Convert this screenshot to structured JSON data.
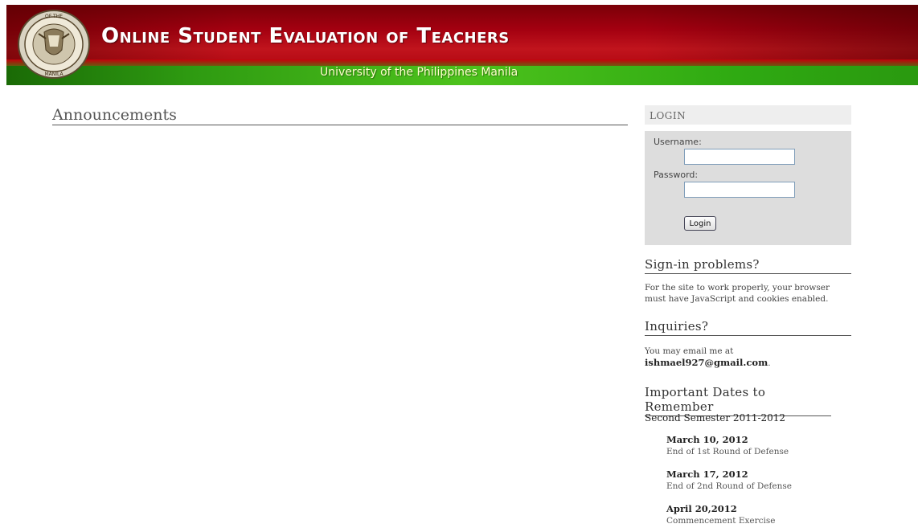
{
  "header": {
    "title": "Online Student Evaluation of Teachers",
    "subtitle": "University of the Philippines Manila",
    "seal_text_top": "OF THE",
    "seal_text_bottom": "MANILA"
  },
  "main": {
    "heading": "Announcements"
  },
  "login": {
    "header": "LOGIN",
    "username_label": "Username:",
    "password_label": "Password:",
    "username_value": "",
    "password_value": "",
    "button_label": "Login"
  },
  "signin": {
    "heading": "Sign-in problems?",
    "text": "For the site to work properly, your browser must have JavaScript and cookies enabled."
  },
  "inquiries": {
    "heading": "Inquiries?",
    "text": "You may email me at",
    "email": "ishmael927@gmail.com",
    "email_suffix": "."
  },
  "dates": {
    "heading": "Important Dates to Remember",
    "semester": "Second Semester 2011-2012",
    "items": [
      {
        "date": "March 10, 2012",
        "event": "End of 1st Round of Defense"
      },
      {
        "date": "March 17, 2012",
        "event": "End of 2nd Round of Defense"
      },
      {
        "date": "April 20,2012",
        "event": "Commencement Exercise"
      }
    ]
  }
}
